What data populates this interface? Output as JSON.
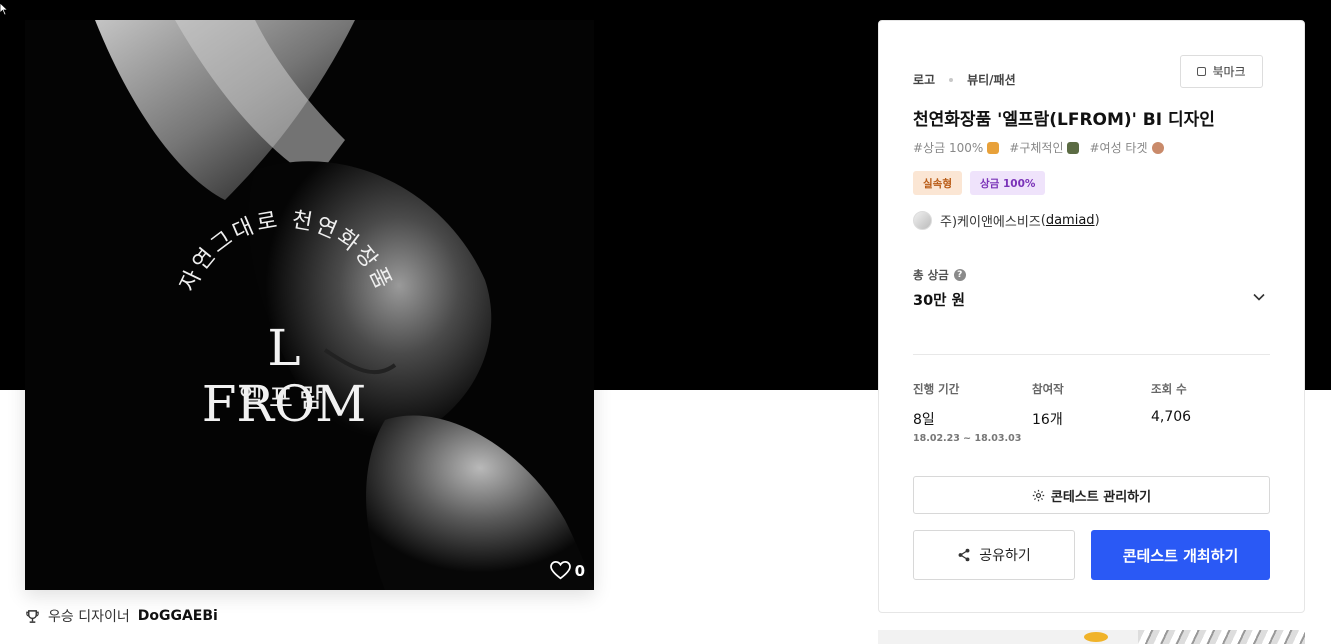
{
  "artwork": {
    "arc_text": "자연그대로 천연화장품",
    "brand": "L FROM",
    "brand_sub": "엘프람",
    "likes": "0"
  },
  "award": {
    "prefix": "우승 디자이너",
    "designer": "DoGGAEBi"
  },
  "panel": {
    "breadcrumb": [
      "로고",
      "뷰티/패션"
    ],
    "bookmark_label": "북마크",
    "title": "천연화장품 '엘프람(LFROM)' BI 디자인",
    "tags": [
      "#상금 100%",
      "#구체적인",
      "#여성 타겟"
    ],
    "badges": [
      "실속형",
      "상금 100%"
    ],
    "host": {
      "company": "주)케이앤에스비즈",
      "handle": "damiad"
    },
    "prize": {
      "label": "총 상금",
      "help": "?",
      "value": "30만 원"
    },
    "stats": {
      "period_label": "진행 기간",
      "period_value": "8일",
      "period_range": "18.02.23 ~ 18.03.03",
      "entries_label": "참여작",
      "entries_value": "16개",
      "views_label": "조회 수",
      "views_value": "4,706"
    },
    "manage_label": "콘테스트 관리하기",
    "share_label": "공유하기",
    "host_contest_label": "콘테스트 개최하기"
  },
  "colors": {
    "primary": "#2a59f5",
    "badge_orange_bg": "#fbe6d4",
    "badge_purple_bg": "#efe3fb"
  }
}
